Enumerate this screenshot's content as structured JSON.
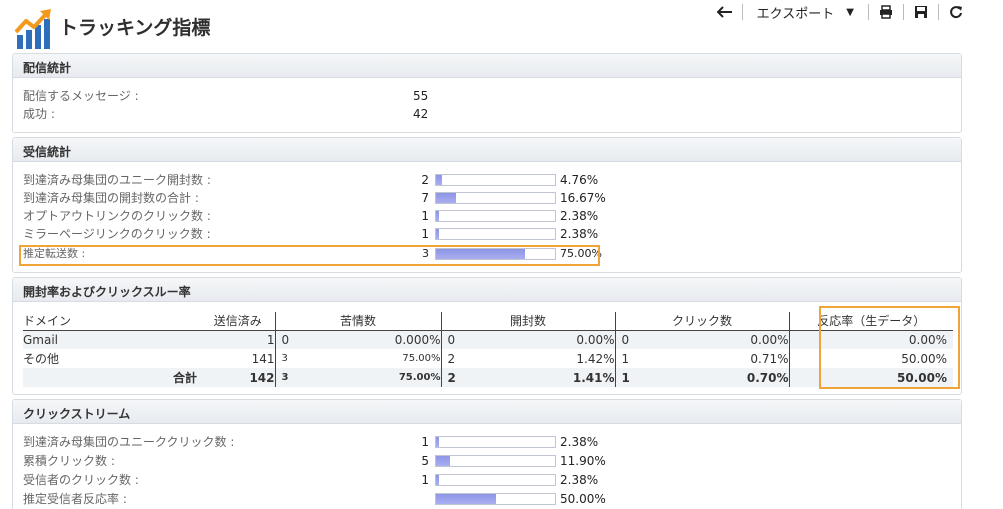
{
  "header": {
    "title": "トラッキング指標"
  },
  "toolbar": {
    "export_label": "エクスポート"
  },
  "delivery": {
    "title": "配信統計",
    "rows": [
      {
        "label": "配信するメッセージ :",
        "value": "55"
      },
      {
        "label": "成功 :",
        "value": "42"
      }
    ]
  },
  "reception": {
    "title": "受信統計",
    "rows": [
      {
        "label": "到達済み母集団のユニーク開封数 :",
        "count": "2",
        "fraction": 0.0476,
        "pct": "4.76%"
      },
      {
        "label": "到達済み母集団の開封数の合計 :",
        "count": "7",
        "fraction": 0.1667,
        "pct": "16.67%"
      },
      {
        "label": "オプトアウトリンクのクリック数 :",
        "count": "1",
        "fraction": 0.0238,
        "pct": "2.38%"
      },
      {
        "label": "ミラーページリンクのクリック数 :",
        "count": "1",
        "fraction": 0.0238,
        "pct": "2.38%"
      },
      {
        "label": "推定転送数 :",
        "count": "3",
        "fraction": 0.75,
        "pct": "75.00%"
      }
    ]
  },
  "open_click": {
    "title": "開封率およびクリックスルー率",
    "headers": {
      "domain": "ドメイン",
      "sent": "送信済み",
      "complaints": "苦情数",
      "opens": "開封数",
      "clicks": "クリック数",
      "reactivity": "反応率（生データ）"
    },
    "rows": [
      {
        "domain": "Gmail",
        "sent": "1",
        "complaints": "0",
        "complaints_pct": "0.000%",
        "opens": "0",
        "opens_pct": "0.00%",
        "clicks": "0",
        "clicks_pct": "0.00%",
        "reactivity": "0.00%"
      },
      {
        "domain": "その他",
        "sent": "141",
        "complaints": "3",
        "complaints_pct": "75.00%",
        "opens": "2",
        "opens_pct": "1.42%",
        "clicks": "1",
        "clicks_pct": "0.71%",
        "reactivity": "50.00%"
      }
    ],
    "total": {
      "label": "合計",
      "sent": "142",
      "complaints": "3",
      "complaints_pct": "75.00%",
      "opens": "2",
      "opens_pct": "1.41%",
      "clicks": "1",
      "clicks_pct": "0.70%",
      "reactivity": "50.00%"
    }
  },
  "clickstream": {
    "title": "クリックストリーム",
    "rows": [
      {
        "label": "到達済み母集団のユニーククリック数 :",
        "count": "1",
        "fraction": 0.0238,
        "pct": "2.38%"
      },
      {
        "label": "累積クリック数 :",
        "count": "5",
        "fraction": 0.119,
        "pct": "11.90%"
      },
      {
        "label": "受信者のクリック数 :",
        "count": "1",
        "fraction": 0.0238,
        "pct": "2.38%"
      },
      {
        "label": "推定受信者反応率 :",
        "count": "",
        "fraction": 0.5,
        "pct": "50.00%"
      }
    ]
  },
  "colors": {
    "accent": "#f0a437",
    "bar": "#8d95e6",
    "logo_orange": "#f39a1c",
    "logo_blue": "#2f6fba"
  }
}
